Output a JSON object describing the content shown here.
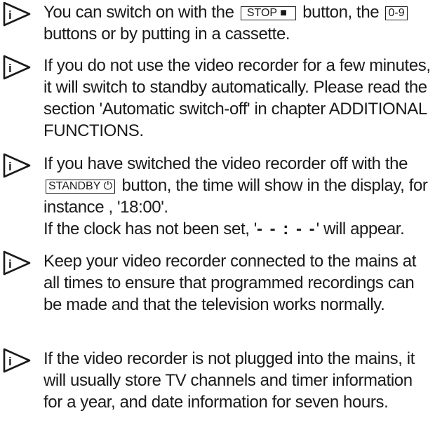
{
  "notes": [
    {
      "parts": [
        {
          "t": "text",
          "v": "You can switch on with the "
        },
        {
          "t": "key",
          "v": "STOP ■",
          "wide": true
        },
        {
          "t": "text",
          "v": " button, the "
        },
        {
          "t": "key",
          "v": "0-9"
        },
        {
          "t": "text",
          "v": " buttons or by putting in a cassette."
        }
      ]
    },
    {
      "parts": [
        {
          "t": "text",
          "v": "If you do not use the video recorder for a few minutes, it will switch to standby automatically. Please read the section 'Automatic switch-off' in chapter ADDITIONAL FUNCTIONS."
        }
      ]
    },
    {
      "parts": [
        {
          "t": "text",
          "v": "If you have switched the video recorder off with the "
        },
        {
          "t": "key",
          "v": "STANDBY ⏻"
        },
        {
          "t": "text",
          "v": " button, the time will show in the display, for instance , '18:00'."
        },
        {
          "t": "br"
        },
        {
          "t": "text",
          "v": "If the clock has not been set, '"
        },
        {
          "t": "clock",
          "v": "- - : - -"
        },
        {
          "t": "text",
          "v": "' will appear."
        }
      ]
    },
    {
      "parts": [
        {
          "t": "text",
          "v": "Keep your video recorder connected to the mains at all times to ensure that programmed recordings can be made and that the television works normally."
        }
      ]
    },
    {
      "parts": [
        {
          "t": "text",
          "v": "If the video recorder is not plugged into the mains, it will usually store TV channels and timer information for a year, and date information for seven hours."
        }
      ]
    }
  ],
  "icons": {
    "note_icon": "info-arrow-icon",
    "icon_letter": "i"
  }
}
